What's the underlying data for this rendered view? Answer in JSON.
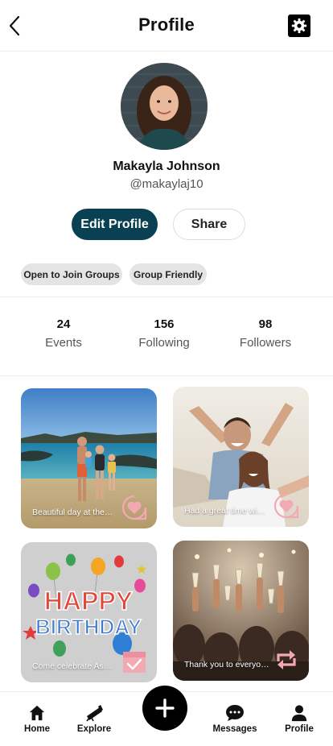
{
  "header": {
    "title": "Profile",
    "back_icon": "chevron-left-icon",
    "settings_icon": "gear-icon"
  },
  "profile": {
    "name": "Makayla Johnson",
    "handle": "@makaylaj10",
    "edit_label": "Edit Profile",
    "share_label": "Share",
    "tags": [
      "Open to Join Groups",
      "Group Friendly"
    ]
  },
  "stats": [
    {
      "value": "24",
      "label": "Events"
    },
    {
      "value": "156",
      "label": "Following"
    },
    {
      "value": "98",
      "label": "Followers"
    }
  ],
  "posts": [
    {
      "caption": "Beautiful day at the…",
      "badge_icon": "heart-icon"
    },
    {
      "caption": "Had a great time wi…",
      "badge_icon": "heart-icon"
    },
    {
      "caption": "Come celebrate As…",
      "badge_icon": "calendar-check-icon",
      "image_text": [
        "HAPPY",
        "BIRTHDAY"
      ]
    },
    {
      "caption": "Thank you to everyo…",
      "badge_icon": "repost-icon"
    }
  ],
  "tabbar": {
    "items": [
      {
        "label": "Home",
        "icon": "home-icon"
      },
      {
        "label": "Explore",
        "icon": "explore-icon"
      },
      {
        "label": "Messages",
        "icon": "chat-bubble-icon"
      },
      {
        "label": "Profile",
        "icon": "person-icon"
      }
    ],
    "fab_icon": "plus-icon"
  },
  "colors": {
    "primary": "#0a4152",
    "badge": "#f3a9b3",
    "tag_bg": "#e4e4e4"
  }
}
